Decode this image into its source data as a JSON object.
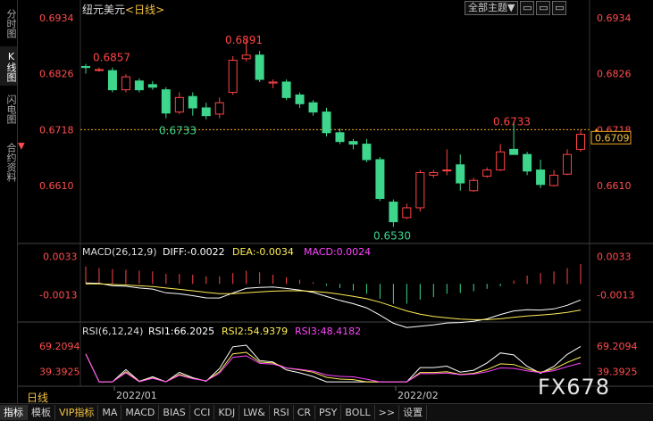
{
  "header": {
    "symbol": "纽元美元",
    "period": "<日线>"
  },
  "toolbar": {
    "theme_select": "全部主题▼",
    "btn1": "▭",
    "btn2": "▭",
    "btn3": "▭"
  },
  "side_tabs": [
    "分时图",
    "K线图",
    "闪电图",
    "合约资料"
  ],
  "price_axis": {
    "levels": [
      0.6934,
      0.6826,
      0.6718,
      0.661
    ],
    "current": "0.6709"
  },
  "annotations": {
    "high1": "0.6857",
    "high2": "0.6891",
    "low1": "0.6733",
    "low2": "0.6530",
    "high3": "0.6733"
  },
  "macd": {
    "label": "MACD(26,12,9)",
    "diff": "DIFF:-0.0022",
    "dea": "DEA:-0.0034",
    "macd": "MACD:0.0024",
    "axis_top": "0.0033",
    "axis_mid": "-0.0013"
  },
  "rsi": {
    "label": "RSI(6,12,24)",
    "rsi1": "RSI1:66.2025",
    "rsi2": "RSI2:54.9379",
    "rsi3": "RSI3:48.4182",
    "axis_top": "69.2094",
    "axis_mid": "39.3925"
  },
  "dates": {
    "d1": "2022/01",
    "d2": "2022/02"
  },
  "period_label": "日线",
  "bottom_tabs": [
    "指标",
    "模板",
    "VIP指标",
    "MA",
    "MACD",
    "BIAS",
    "CCI",
    "KDJ",
    "LW&",
    "RSI",
    "CR",
    "PSY",
    "BOLL",
    ">>",
    "设置"
  ],
  "watermark": "FX678",
  "colors": {
    "up": "#ff4444",
    "down": "#3dd68c",
    "axis": "#ff4d4d",
    "diff": "#ffffff",
    "dea": "#ffee55",
    "macd": "#ff44ff"
  },
  "chart_data": {
    "type": "candlestick",
    "candles": [
      [
        0.684,
        0.6845,
        0.6826,
        0.6838
      ],
      [
        0.6833,
        0.6838,
        0.683,
        0.6834
      ],
      [
        0.6832,
        0.6838,
        0.679,
        0.6795
      ],
      [
        0.6795,
        0.6825,
        0.679,
        0.682
      ],
      [
        0.6812,
        0.6817,
        0.679,
        0.6795
      ],
      [
        0.6805,
        0.6812,
        0.6795,
        0.68
      ],
      [
        0.6795,
        0.68,
        0.674,
        0.675
      ],
      [
        0.6752,
        0.679,
        0.6748,
        0.678
      ],
      [
        0.6782,
        0.679,
        0.6745,
        0.676
      ],
      [
        0.676,
        0.677,
        0.6738,
        0.6745
      ],
      [
        0.6748,
        0.678,
        0.674,
        0.677
      ],
      [
        0.679,
        0.686,
        0.6785,
        0.6852
      ],
      [
        0.6855,
        0.6891,
        0.685,
        0.6862
      ],
      [
        0.6862,
        0.687,
        0.681,
        0.6815
      ],
      [
        0.6808,
        0.6815,
        0.6798,
        0.681
      ],
      [
        0.681,
        0.6815,
        0.6775,
        0.678
      ],
      [
        0.6785,
        0.679,
        0.676,
        0.6768
      ],
      [
        0.677,
        0.6775,
        0.6745,
        0.6752
      ],
      [
        0.6752,
        0.676,
        0.6705,
        0.6712
      ],
      [
        0.6712,
        0.672,
        0.669,
        0.6695
      ],
      [
        0.6695,
        0.67,
        0.668,
        0.669
      ],
      [
        0.669,
        0.67,
        0.6655,
        0.666
      ],
      [
        0.666,
        0.6665,
        0.658,
        0.6585
      ],
      [
        0.6578,
        0.6583,
        0.653,
        0.654
      ],
      [
        0.6548,
        0.6575,
        0.6545,
        0.6567
      ],
      [
        0.6567,
        0.664,
        0.656,
        0.6635
      ],
      [
        0.663,
        0.664,
        0.6625,
        0.6635
      ],
      [
        0.664,
        0.668,
        0.663,
        0.664
      ],
      [
        0.665,
        0.667,
        0.66,
        0.6615
      ],
      [
        0.66,
        0.6625,
        0.6598,
        0.662
      ],
      [
        0.6628,
        0.6645,
        0.6625,
        0.664
      ],
      [
        0.664,
        0.669,
        0.6638,
        0.6675
      ],
      [
        0.668,
        0.6733,
        0.667,
        0.667
      ],
      [
        0.667,
        0.6675,
        0.663,
        0.6638
      ],
      [
        0.664,
        0.666,
        0.6605,
        0.6612
      ],
      [
        0.661,
        0.664,
        0.6608,
        0.663
      ],
      [
        0.6632,
        0.668,
        0.663,
        0.667
      ],
      [
        0.668,
        0.6718,
        0.6675,
        0.6709
      ]
    ],
    "macd_hist": [
      0.0021,
      0.0019,
      0.0018,
      0.0017,
      0.0016,
      0.0015,
      0.0012,
      0.0012,
      0.0011,
      0.0009,
      0.0009,
      0.0013,
      0.0016,
      0.0014,
      0.0011,
      0.0008,
      0.0005,
      0.0002,
      -0.0002,
      -0.0005,
      -0.0008,
      -0.0012,
      -0.0018,
      -0.0024,
      -0.0024,
      -0.0019,
      -0.0016,
      -0.0012,
      -0.0011,
      -0.0009,
      -0.0006,
      -0.0003,
      0.0004,
      0.001,
      0.0013,
      0.0015,
      0.0019,
      0.0024
    ],
    "macd_range": [
      -0.0045,
      0.0038
    ],
    "rsi_range": [
      25,
      80
    ]
  }
}
